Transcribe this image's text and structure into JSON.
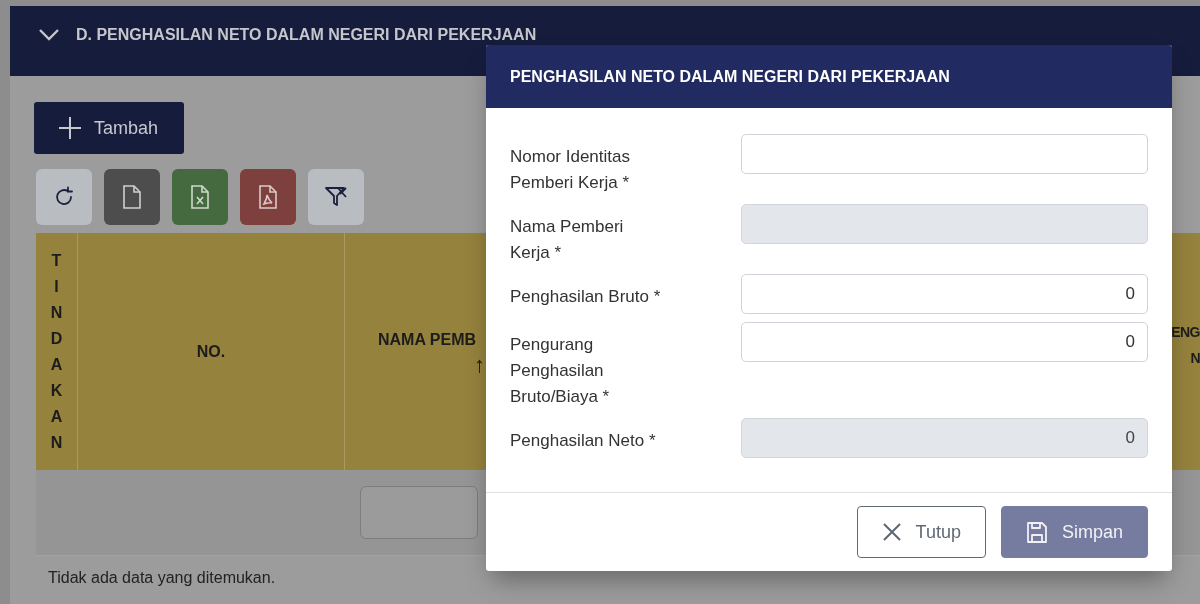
{
  "section": {
    "title": "D. PENGHASILAN NETO DALAM NEGERI DARI PEKERJAAN",
    "expanded": true
  },
  "add_button": {
    "label": "Tambah"
  },
  "toolbar": [
    {
      "kind": "refresh"
    },
    {
      "kind": "file"
    },
    {
      "kind": "excel"
    },
    {
      "kind": "pdf"
    },
    {
      "kind": "filter"
    }
  ],
  "table": {
    "columns": [
      {
        "label": "TINDAKAN",
        "kind": "vertical"
      },
      {
        "label": "NO.",
        "kind": "plain"
      },
      {
        "label": "NAMA PEMB",
        "sort_arrow": "↑",
        "kind": "plain"
      },
      {
        "label": "ENG N",
        "kind": "plain"
      }
    ],
    "empty_message": "Tidak ada data yang ditemukan."
  },
  "modal": {
    "title": "PENGHASILAN NETO DALAM NEGERI DARI PEKERJAAN",
    "fields": [
      {
        "label": "Nomor Identitas Pemberi Kerja *",
        "disabled": false
      },
      {
        "label": "Nama Pemberi Kerja *",
        "disabled": true
      },
      {
        "label": "Penghasilan Bruto *",
        "value": "0",
        "disabled": false
      },
      {
        "label": "Pengurang Penghasilan Bruto/Biaya *",
        "value": "0",
        "disabled": false
      },
      {
        "label": "Penghasilan Neto *",
        "value": "0",
        "disabled": true
      }
    ],
    "buttons": [
      {
        "kind": "close",
        "label": "Tutup"
      },
      {
        "kind": "save",
        "label": "Simpan"
      }
    ]
  }
}
